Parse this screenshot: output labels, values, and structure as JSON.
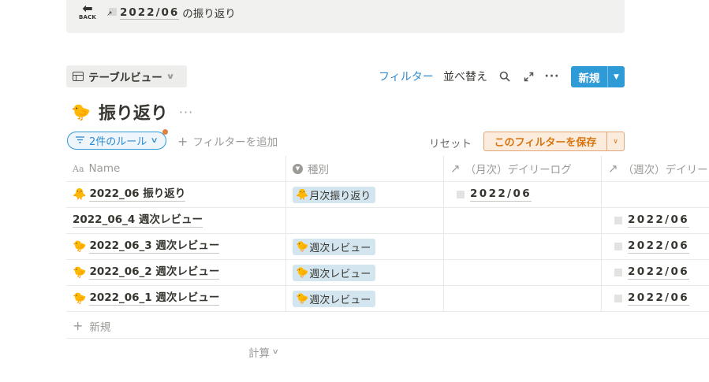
{
  "top_bar": {
    "back_label": "BACK",
    "link_date": "2022/06",
    "link_suffix": "の振り返り"
  },
  "toolbar": {
    "view_label": "テーブルビュー",
    "filter_label": "フィルター",
    "sort_label": "並べ替え",
    "new_label": "新規"
  },
  "page": {
    "icon": "🐤",
    "title": "振り返り",
    "more": "···"
  },
  "filter_bar": {
    "rule_label": "2件のルール",
    "add_filter_label": "フィルターを追加",
    "reset_label": "リセット",
    "save_label": "このフィルターを保存"
  },
  "table": {
    "columns": [
      {
        "icon": "Aa",
        "label": "Name"
      },
      {
        "icon": "select",
        "label": "種別"
      },
      {
        "icon": "↗",
        "label": "（月次）デイリーログ"
      },
      {
        "icon": "↗",
        "label": "（週次）デイリーログ"
      }
    ],
    "rows": [
      {
        "emoji": "🐥",
        "name": "2022_06 振り返り",
        "tag_emoji": "🐥",
        "tag": "月次振り返り",
        "monthly": "2022/06",
        "weekly": ""
      },
      {
        "emoji": "",
        "name": "2022_06_4 週次レビュー",
        "tag_emoji": "",
        "tag": "",
        "monthly": "",
        "weekly": "2022/06"
      },
      {
        "emoji": "🐤",
        "name": "2022_06_3 週次レビュー",
        "tag_emoji": "🐤",
        "tag": "週次レビュー",
        "monthly": "",
        "weekly": "2022/06"
      },
      {
        "emoji": "🐤",
        "name": "2022_06_2 週次レビュー",
        "tag_emoji": "🐤",
        "tag": "週次レビュー",
        "monthly": "",
        "weekly": "2022/06"
      },
      {
        "emoji": "🐤",
        "name": "2022_06_1 週次レビュー",
        "tag_emoji": "🐤",
        "tag": "週次レビュー",
        "monthly": "",
        "weekly": "2022/06"
      }
    ],
    "new_row_label": "新規",
    "calc_label": "計算"
  },
  "colors": {
    "accent": "#2e9ad6",
    "save_accent": "#d9730d",
    "tag_bg": "#d3e5ef"
  }
}
